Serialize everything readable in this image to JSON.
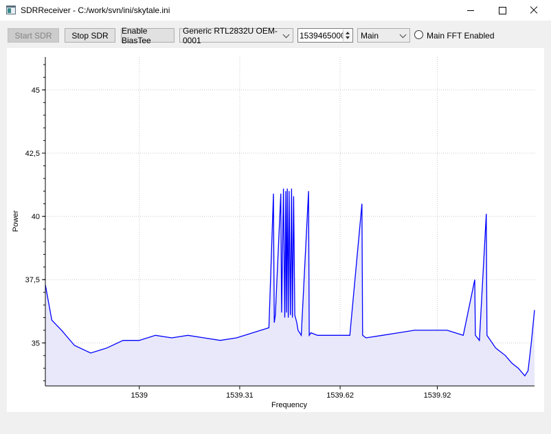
{
  "window": {
    "title": "SDRReceiver - C:/work/svn/ini/skytale.ini"
  },
  "toolbar": {
    "start_label": "Start SDR",
    "stop_label": "Stop SDR",
    "biastee_label": "Enable BiasTee",
    "device_selected": "Generic RTL2832U OEM-0001",
    "frequency_value": "1539465000",
    "fft_source_selected": "Main",
    "fft_enabled_label": "Main FFT Enabled"
  },
  "colors": {
    "trace": "#0000ff",
    "fill": "#e8e8fa",
    "grid": "#c8c8c8"
  },
  "chart_data": {
    "type": "area",
    "xlabel": "Frequency",
    "ylabel": "Power",
    "xlim": [
      1538.71,
      1540.22
    ],
    "ylim": [
      33.3,
      46.3
    ],
    "x_ticks": [
      1539,
      1539.31,
      1539.62,
      1539.92
    ],
    "x_tick_labels": [
      "1539",
      "1539.31",
      "1539.62",
      "1539.92"
    ],
    "y_ticks": [
      35,
      37.5,
      40,
      42.5,
      45
    ],
    "y_tick_labels": [
      "35",
      "37,5",
      "40",
      "42,5",
      "45"
    ],
    "grid": true,
    "series": [
      {
        "x": [
          1538.71,
          1538.73,
          1538.76,
          1538.8,
          1538.85,
          1538.9,
          1538.95,
          1539.0,
          1539.05,
          1539.1,
          1539.15,
          1539.2,
          1539.25,
          1539.3,
          1539.35,
          1539.4,
          1539.4142,
          1539.4167,
          1539.42,
          1539.4368,
          1539.4394,
          1539.445,
          1539.4491,
          1539.4522,
          1539.4545,
          1539.457,
          1539.46,
          1539.4624,
          1539.4665,
          1539.47,
          1539.4726,
          1539.4764,
          1539.48,
          1539.4822,
          1539.4862,
          1539.49,
          1539.5,
          1539.5,
          1539.5224,
          1539.5247,
          1539.53,
          1539.55,
          1539.6,
          1539.65,
          1539.6872,
          1539.6893,
          1539.7,
          1539.75,
          1539.8,
          1539.85,
          1539.9,
          1539.95,
          1540.0,
          1540.0354,
          1540.0375,
          1540.05,
          1540.0712,
          1540.0733,
          1540.1,
          1540.13,
          1540.15,
          1540.17,
          1540.19,
          1540.2,
          1540.21,
          1540.22
        ],
        "y": [
          37.3,
          35.9,
          35.5,
          34.9,
          34.6,
          34.8,
          35.1,
          35.1,
          35.3,
          35.2,
          35.3,
          35.2,
          35.1,
          35.2,
          35.4,
          35.6,
          40.9,
          35.8,
          36.1,
          40.9,
          36.2,
          41.1,
          36.0,
          41.0,
          36.2,
          41.1,
          36.0,
          41.0,
          36.1,
          41.1,
          36.0,
          40.8,
          36.1,
          36.0,
          35.8,
          35.5,
          35.3,
          35.3,
          41.0,
          35.3,
          35.4,
          35.3,
          35.3,
          35.3,
          40.5,
          35.3,
          35.2,
          35.3,
          35.4,
          35.5,
          35.5,
          35.5,
          35.3,
          37.5,
          35.3,
          35.1,
          40.1,
          35.3,
          34.8,
          34.5,
          34.2,
          34.0,
          33.7,
          33.9,
          35.0,
          36.3
        ]
      }
    ]
  }
}
